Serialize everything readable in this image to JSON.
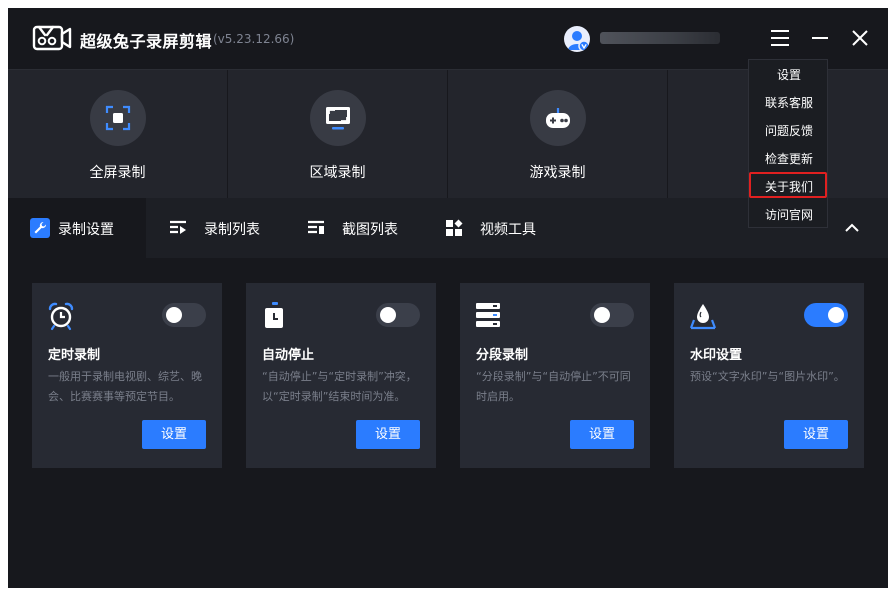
{
  "app": {
    "title": "超级兔子录屏剪辑",
    "version": "(v5.23.12.66)",
    "brand_color": "#2b7cff"
  },
  "titlebar": {
    "icons": [
      "avatar-icon",
      "menu-icon",
      "minimize-icon",
      "close-icon"
    ]
  },
  "modes": [
    {
      "label": "全屏录制",
      "icon": "fullscreen-record-icon"
    },
    {
      "label": "区域录制",
      "icon": "region-record-icon"
    },
    {
      "label": "游戏录制",
      "icon": "gamepad-icon"
    }
  ],
  "tabs": [
    {
      "label": "录制设置",
      "icon": "wrench-icon",
      "active": true
    },
    {
      "label": "录制列表",
      "icon": "video-list-icon",
      "active": false
    },
    {
      "label": "截图列表",
      "icon": "screenshot-list-icon",
      "active": false
    },
    {
      "label": "视频工具",
      "icon": "tools-grid-icon",
      "active": false
    }
  ],
  "cards": [
    {
      "title": "定时录制",
      "desc": "一般用于录制电视剧、综艺、晚会、比赛赛事等预定节目。",
      "button": "设置",
      "toggle_on": false,
      "icon": "alarm-clock-icon"
    },
    {
      "title": "自动停止",
      "desc": "“自动停止”与“定时录制”冲突，以“定时录制”结束时间为准。",
      "button": "设置",
      "toggle_on": false,
      "icon": "timer-icon"
    },
    {
      "title": "分段录制",
      "desc": "“分段录制”与“自动停止”不可同时启用。",
      "button": "设置",
      "toggle_on": false,
      "icon": "segments-icon"
    },
    {
      "title": "水印设置",
      "desc": "预设“文字水印”与“图片水印”。",
      "button": "设置",
      "toggle_on": true,
      "icon": "watermark-drop-icon"
    }
  ],
  "menu": {
    "items": [
      "设置",
      "联系客服",
      "问题反馈",
      "检查更新",
      "关于我们",
      "访问官网"
    ],
    "highlighted": "关于我们",
    "highlight_color": "#e02020"
  }
}
